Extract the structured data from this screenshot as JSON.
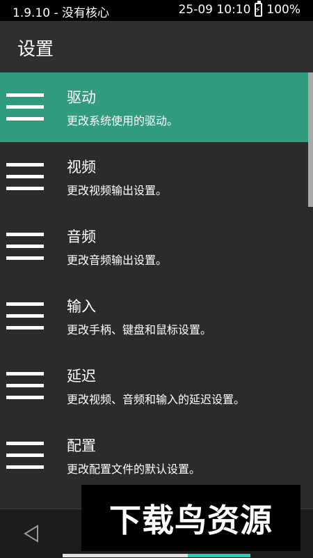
{
  "status_bar": {
    "left_text": "1.9.10 - 没有核心",
    "datetime": "25-09 10:10",
    "battery": "100%",
    "battery_icon": "battery-charging-icon"
  },
  "app_bar": {
    "title": "设置"
  },
  "settings_items": [
    {
      "title": "驱动",
      "subtitle": "更改系统使用的驱动。",
      "selected": true,
      "icon": "menu-icon"
    },
    {
      "title": "视频",
      "subtitle": "更改视频输出设置。",
      "selected": false,
      "icon": "menu-icon"
    },
    {
      "title": "音频",
      "subtitle": "更改音频输出设置。",
      "selected": false,
      "icon": "menu-icon"
    },
    {
      "title": "输入",
      "subtitle": "更改手柄、键盘和鼠标设置。",
      "selected": false,
      "icon": "menu-icon"
    },
    {
      "title": "延迟",
      "subtitle": "更改视频、音频和输入的延迟设置。",
      "selected": false,
      "icon": "menu-icon"
    },
    {
      "title": "配置",
      "subtitle": "更改配置文件的默认设置。",
      "selected": false,
      "icon": "menu-icon"
    }
  ],
  "watermark": {
    "text": "下载鸟资源"
  },
  "colors": {
    "accent": "#319b80",
    "background": "#2b2b2b",
    "app_bar": "#2f2f2f",
    "status_bar": "#000000"
  }
}
